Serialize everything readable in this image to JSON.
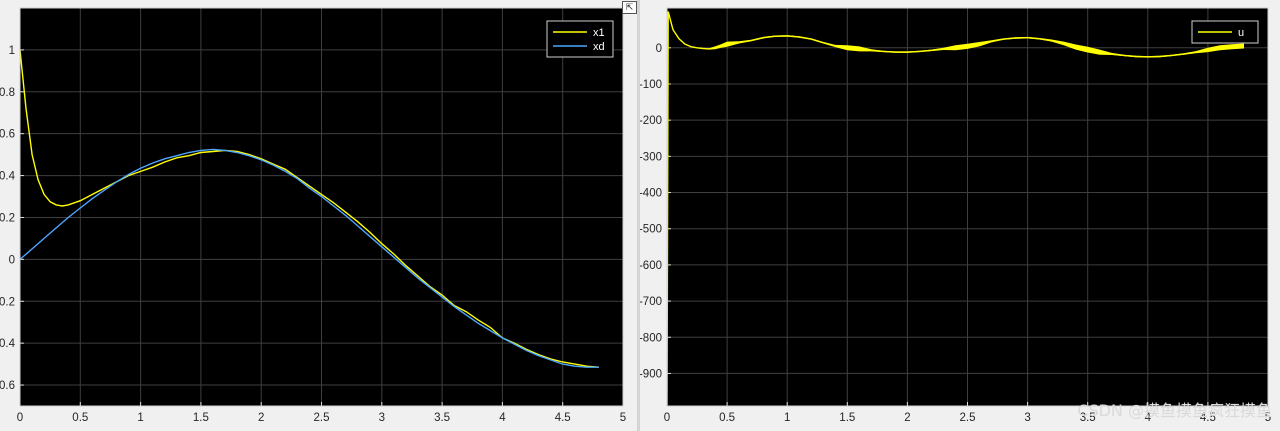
{
  "chart_data": [
    {
      "type": "line",
      "title": "",
      "xlabel": "",
      "ylabel": "",
      "xlim": [
        0,
        5
      ],
      "ylim": [
        -0.7,
        1.2
      ],
      "xticks": [
        0,
        0.5,
        1,
        1.5,
        2,
        2.5,
        3,
        3.5,
        4,
        4.5,
        5
      ],
      "xtick_labels": [
        "0",
        "0.5",
        "1",
        "1.5",
        "2",
        "2.5",
        "3",
        "3.5",
        "4",
        "4.5",
        "5"
      ],
      "yticks": [
        1,
        0.8,
        0.6,
        0.4,
        0.2,
        0,
        -0.2,
        -0.4,
        -0.6
      ],
      "ytick_labels": [
        "1",
        "0.8",
        "0.6",
        "0.4",
        "0.2",
        "0",
        "0.2",
        "0.4",
        "0.6"
      ],
      "grid": true,
      "legend": "top-right",
      "background": "#000000",
      "series": [
        {
          "name": "x1",
          "color": "#ffff00",
          "x": [
            0,
            0.05,
            0.1,
            0.15,
            0.2,
            0.25,
            0.3,
            0.35,
            0.4,
            0.5,
            0.6,
            0.7,
            0.8,
            0.9,
            1.0,
            1.1,
            1.2,
            1.3,
            1.4,
            1.5,
            1.6,
            1.7,
            1.8,
            1.9,
            2.0,
            2.1,
            2.2,
            2.3,
            2.4,
            2.5,
            2.6,
            2.7,
            2.8,
            2.9,
            3.0,
            3.1,
            3.2,
            3.3,
            3.4,
            3.5,
            3.6,
            3.7,
            3.8,
            3.9,
            4.0,
            4.1,
            4.2,
            4.3,
            4.4,
            4.5,
            4.6,
            4.7,
            4.8
          ],
          "y": [
            1.0,
            0.72,
            0.5,
            0.38,
            0.31,
            0.275,
            0.26,
            0.255,
            0.26,
            0.28,
            0.31,
            0.34,
            0.37,
            0.4,
            0.42,
            0.44,
            0.465,
            0.485,
            0.495,
            0.51,
            0.515,
            0.52,
            0.515,
            0.5,
            0.48,
            0.455,
            0.43,
            0.39,
            0.35,
            0.31,
            0.27,
            0.225,
            0.18,
            0.13,
            0.075,
            0.025,
            -0.03,
            -0.08,
            -0.13,
            -0.17,
            -0.22,
            -0.25,
            -0.29,
            -0.325,
            -0.375,
            -0.4,
            -0.43,
            -0.455,
            -0.475,
            -0.49,
            -0.5,
            -0.51,
            -0.515
          ]
        },
        {
          "name": "xd",
          "color": "#4da6ff",
          "x": [
            0,
            0.1,
            0.2,
            0.3,
            0.4,
            0.5,
            0.6,
            0.7,
            0.8,
            0.9,
            1.0,
            1.1,
            1.2,
            1.3,
            1.4,
            1.5,
            1.6,
            1.7,
            1.8,
            1.9,
            2.0,
            2.1,
            2.2,
            2.3,
            2.4,
            2.5,
            2.6,
            2.7,
            2.8,
            2.9,
            3.0,
            3.1,
            3.2,
            3.3,
            3.4,
            3.5,
            3.6,
            3.7,
            3.8,
            3.9,
            4.0,
            4.1,
            4.2,
            4.3,
            4.4,
            4.5,
            4.6,
            4.7,
            4.8
          ],
          "y": [
            0,
            0.05,
            0.1,
            0.15,
            0.2,
            0.245,
            0.29,
            0.33,
            0.37,
            0.405,
            0.435,
            0.46,
            0.48,
            0.495,
            0.51,
            0.52,
            0.525,
            0.52,
            0.51,
            0.495,
            0.475,
            0.45,
            0.42,
            0.385,
            0.34,
            0.3,
            0.255,
            0.21,
            0.16,
            0.11,
            0.06,
            0.01,
            -0.04,
            -0.09,
            -0.135,
            -0.18,
            -0.225,
            -0.265,
            -0.305,
            -0.34,
            -0.375,
            -0.405,
            -0.435,
            -0.46,
            -0.48,
            -0.5,
            -0.51,
            -0.515,
            -0.515
          ]
        }
      ]
    },
    {
      "type": "line",
      "title": "",
      "xlabel": "",
      "ylabel": "",
      "xlim": [
        0,
        5
      ],
      "ylim": [
        -990,
        110
      ],
      "xticks": [
        0,
        0.5,
        1,
        1.5,
        2,
        2.5,
        3,
        3.5,
        4,
        4.5,
        5
      ],
      "xtick_labels": [
        "0",
        "0.5",
        "1",
        "1.5",
        "2",
        "2.5",
        "3",
        "3.5",
        "4",
        "4.5",
        "5"
      ],
      "yticks": [
        0,
        -100,
        -200,
        -300,
        -400,
        -500,
        -600,
        -700,
        -800,
        -900
      ],
      "ytick_labels": [
        "0",
        "-100",
        "-200",
        "-300",
        "-400",
        "-500",
        "-600",
        "-700",
        "-800",
        "-900"
      ],
      "grid": true,
      "legend": "top-right",
      "background": "#000000",
      "series": [
        {
          "name": "u",
          "color": "#ffff00",
          "x": [
            0.0,
            0.01,
            0.05,
            0.1,
            0.15,
            0.2,
            0.25,
            0.3,
            0.35,
            0.4,
            0.45,
            0.5,
            0.6,
            0.7,
            0.8,
            0.9,
            1.0,
            1.1,
            1.2,
            1.3,
            1.4,
            1.5,
            1.6,
            1.7,
            1.8,
            1.9,
            2.0,
            2.1,
            2.2,
            2.3,
            2.4,
            2.5,
            2.6,
            2.7,
            2.8,
            2.9,
            3.0,
            3.1,
            3.2,
            3.3,
            3.4,
            3.5,
            3.6,
            3.7,
            3.8,
            3.9,
            4.0,
            4.1,
            4.2,
            4.3,
            4.4,
            4.5,
            4.6,
            4.7,
            4.8
          ],
          "y": [
            -990,
            100,
            50,
            25,
            10,
            3,
            0,
            -2,
            -3,
            0,
            5,
            10,
            15,
            20,
            28,
            32,
            33,
            30,
            24,
            14,
            5,
            0,
            -3,
            -7,
            -10,
            -12,
            -12,
            -10,
            -7,
            -3,
            0,
            4,
            10,
            18,
            24,
            27,
            28,
            25,
            20,
            12,
            2,
            -5,
            -12,
            -17,
            -21,
            -24,
            -25,
            -24,
            -21,
            -17,
            -12,
            -6,
            0,
            3,
            5
          ],
          "band": [
            0,
            0,
            0,
            0,
            0,
            0,
            0,
            0,
            4,
            8,
            10,
            14,
            6,
            4,
            4,
            4,
            4,
            4,
            4,
            4,
            6,
            14,
            14,
            6,
            4,
            4,
            4,
            4,
            4,
            6,
            14,
            14,
            12,
            6,
            4,
            4,
            4,
            4,
            6,
            10,
            14,
            16,
            14,
            6,
            4,
            4,
            4,
            4,
            4,
            4,
            6,
            12,
            14,
            14,
            14
          ]
        }
      ]
    }
  ],
  "axes_toolbar_glyph": "⇱",
  "watermark": "CSDN @摸鱼摸鱼疯狂摸鱼"
}
